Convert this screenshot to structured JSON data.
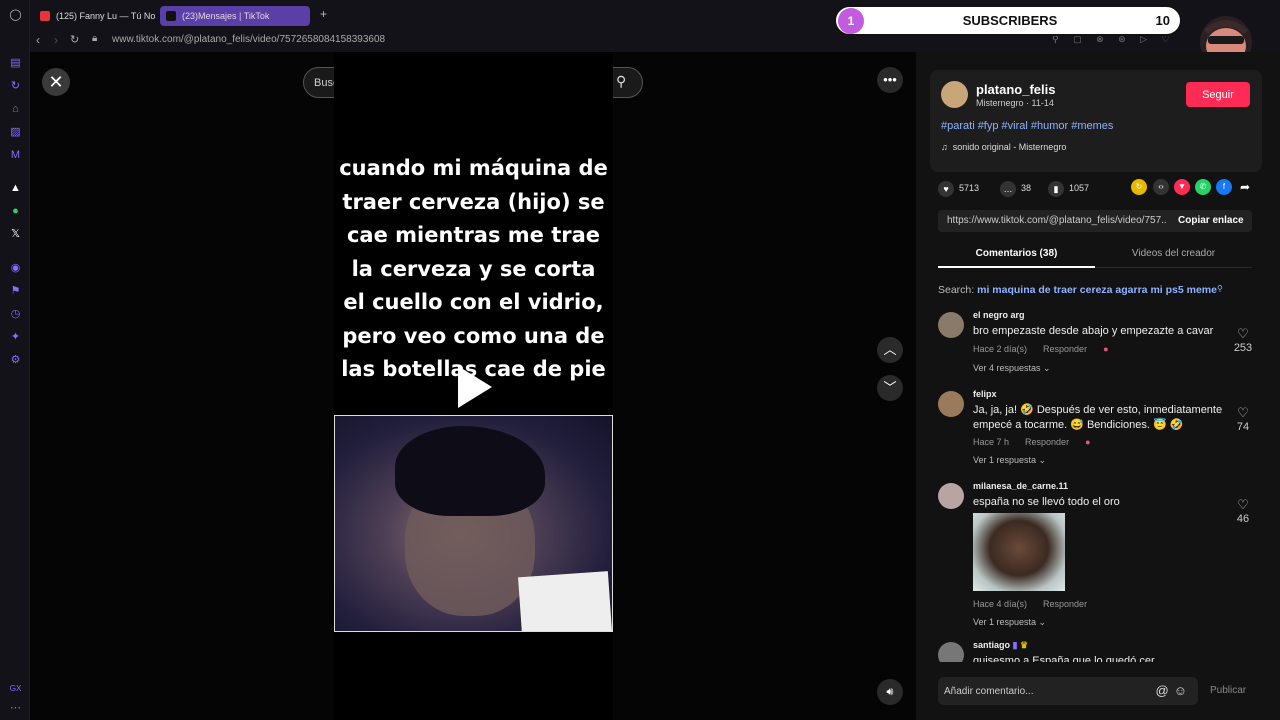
{
  "browser": {
    "tabs": [
      {
        "label": "(125) Fanny Lu — Tú No Es",
        "icon_color": "#e8333a"
      },
      {
        "label": "(23)Mensajes | TikTok",
        "icon_color": "#111111"
      }
    ],
    "new_tab": "+",
    "url": "www.tiktok.com/@platano_felis/video/7572658084158393608"
  },
  "overlay": {
    "subscriber_goal_index": "1",
    "subscribers_label": "SUBSCRIBERS",
    "subscribers_count": "10"
  },
  "video": {
    "search_placeholder": "Buscar contenido relacionado",
    "caption": "cuando mi máquina de traer cerveza (hijo) se cae mientras me trae la cerveza y se corta el cuello con el vidrio, pero veo como una de las botellas cae de pie"
  },
  "author": {
    "username": "platano_felis",
    "nickname": "Misternegro",
    "date": "11-14",
    "follow_label": "Seguir",
    "hashtags": "#parati #fyp #viral #humor #memes",
    "sound": "sonido original - Misternegro"
  },
  "stats": {
    "likes": "5713",
    "comments": "38",
    "saves": "1057"
  },
  "share": {
    "link": "https://www.tiktok.com/@platano_felis/video/757...",
    "copy_label": "Copiar enlace"
  },
  "tabs": {
    "comments": "Comentarios (38)",
    "creator_videos": "Videos del creador"
  },
  "search_suggestion": {
    "prefix": "Search:",
    "query": "mi maquina de traer cereza agarra mi ps5 meme"
  },
  "comments": [
    {
      "user": "el negro arg",
      "text": "bro empezaste desde abajo y empezazte a cavar",
      "time": "Hace 2 día(s)",
      "reply": "Responder",
      "replies": "Ver 4 respuestas",
      "likes": "253"
    },
    {
      "user": "felipx",
      "text": "Ja, ja, ja! 🤣 Después de ver esto, inmediatamente empecé a tocarme. 😅 Bendiciones. 😇 🤣",
      "time": "Hace 7 h",
      "reply": "Responder",
      "replies": "Ver 1 respuesta",
      "likes": "74"
    },
    {
      "user": "milanesa_de_carne.11",
      "text": "españa no se llevó todo el oro",
      "time": "Hace 4 día(s)",
      "reply": "Responder",
      "replies": "Ver 1 respuesta",
      "likes": "46"
    },
    {
      "user": "santiago",
      "text": "quisesmo a España que lo quedó cer...",
      "time": "",
      "reply": "",
      "replies": "",
      "likes": ""
    }
  ],
  "comment_input": {
    "placeholder": "Añadir comentario...",
    "publish_label": "Publicar"
  },
  "colors": {
    "accent": "#fe2c55",
    "browser_accent": "#8a6cff",
    "link": "#8fb3ff"
  }
}
